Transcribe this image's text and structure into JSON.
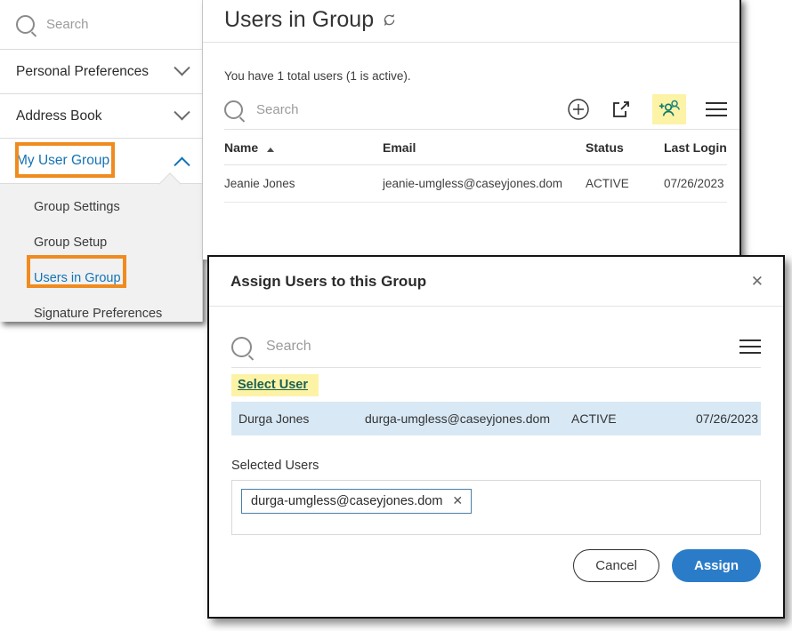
{
  "sidebar": {
    "search": {
      "placeholder": "Search",
      "icon": "search-icon"
    },
    "items": [
      {
        "label": "Personal Preferences",
        "icon": "chevron-down-icon",
        "expanded": false,
        "highlighted": false
      },
      {
        "label": "Address Book",
        "icon": "chevron-down-icon",
        "expanded": false,
        "highlighted": false
      },
      {
        "label": "My User Group",
        "icon": "chevron-up-icon",
        "expanded": true,
        "highlighted": true
      }
    ],
    "submenu": [
      {
        "label": "Group Settings",
        "highlighted": false
      },
      {
        "label": "Group Setup",
        "highlighted": false
      },
      {
        "label": "Users in Group",
        "highlighted": true
      },
      {
        "label": "Signature Preferences",
        "highlighted": false
      }
    ]
  },
  "main": {
    "title": "Users in Group",
    "title_icon": "refresh-icon",
    "count_text": "You have 1 total users (1 is active).",
    "search": {
      "placeholder": "Search",
      "icon": "search-icon"
    },
    "toolbar_icons": [
      {
        "name": "add-circle-icon",
        "highlighted": false
      },
      {
        "name": "export-share-icon",
        "highlighted": false
      },
      {
        "name": "assign-users-icon",
        "highlighted": true
      },
      {
        "name": "menu-hamburger-icon",
        "highlighted": false
      }
    ],
    "table": {
      "columns": [
        "Name",
        "Email",
        "Status",
        "Last Login"
      ],
      "sort_column": "Name",
      "sort_direction": "asc",
      "rows": [
        {
          "name": "Jeanie Jones",
          "email": "jeanie-umgless@caseyjones.dom",
          "status": "ACTIVE",
          "last_login": "07/26/2023"
        }
      ]
    }
  },
  "modal": {
    "title": "Assign Users to this Group",
    "close_icon": "close-icon",
    "search": {
      "placeholder": "Search",
      "icon": "search-icon"
    },
    "menu_icon": "menu-hamburger-icon",
    "select_user_link": "Select User",
    "result_row": {
      "name": "Durga Jones",
      "email": "durga-umgless@caseyjones.dom",
      "status": "ACTIVE",
      "last_login": "07/26/2023"
    },
    "selected_users_label": "Selected Users",
    "chips": [
      {
        "text": "durga-umgless@caseyjones.dom",
        "remove_icon": "close-icon"
      }
    ],
    "cancel_label": "Cancel",
    "assign_label": "Assign"
  },
  "colors": {
    "highlight_box": "#ef8b1f",
    "highlight_mark": "#fdf3a6",
    "link_blue": "#1473b5",
    "assign_button": "#2b7cc8",
    "selected_row": "#d8e8f5",
    "assign_icon_teal": "#0f7a6b"
  },
  "cursor": {
    "type": "pointer-hand-cursor"
  }
}
